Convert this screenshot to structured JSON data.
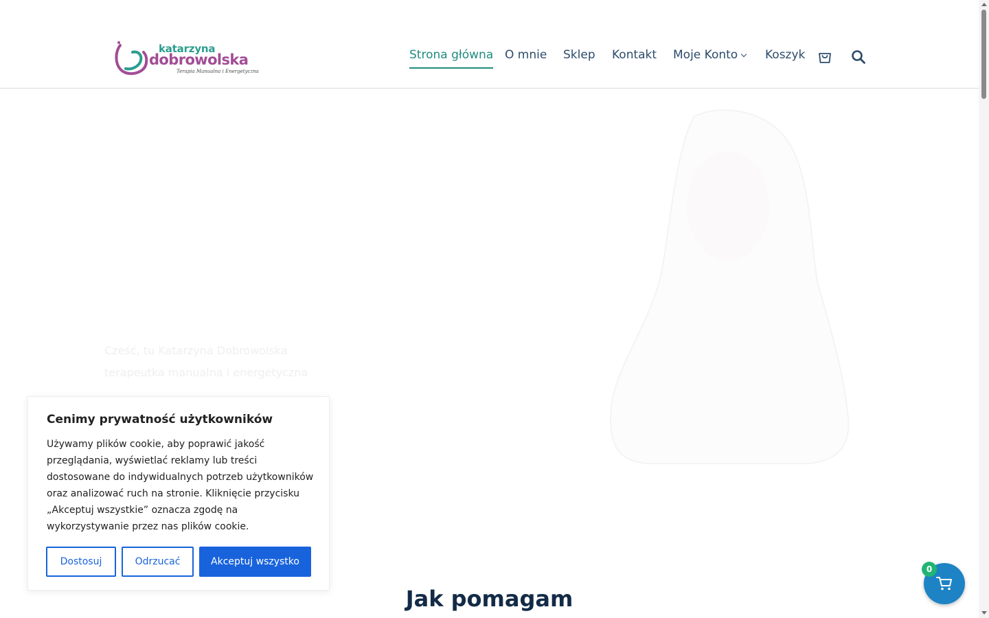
{
  "logo": {
    "line1": "katarzyna",
    "line2": "dobrowolska",
    "tagline": "Terapia Manualna i Energetyczna"
  },
  "nav": {
    "items": [
      {
        "label": "Strona główna",
        "active": true
      },
      {
        "label": "O mnie"
      },
      {
        "label": "Sklep"
      },
      {
        "label": "Kontakt"
      },
      {
        "label": "Moje Konto",
        "has_dropdown": true
      },
      {
        "label": "Koszyk"
      }
    ],
    "icons": [
      "cart-icon",
      "search-icon"
    ]
  },
  "hero": {
    "ghost_lines": [
      "Cześć, tu Katarzyna Dobrowolska",
      "terapeutka manualna i energetyczna"
    ]
  },
  "section": {
    "title": "Jak pomagam"
  },
  "cookie": {
    "title": "Cenimy prywatność użytkowników",
    "text": "Używamy plików cookie, aby poprawić jakość przeglądania, wyświetlać reklamy lub treści dostosowane do indywidualnych potrzeb użytkowników oraz analizować ruch na stronie. Kliknięcie przycisku „Akceptuj wszystkie” oznacza zgodę na wykorzystywanie przez nas plików cookie.",
    "buttons": {
      "customize": "Dostosuj",
      "reject": "Odrzucać",
      "accept": "Akceptuj wszystko"
    }
  },
  "minicart": {
    "count": "0"
  },
  "colors": {
    "accent": "#1f8c7f",
    "nav_text": "#2d4b6b",
    "cookie_button": "#1863dc",
    "cart_fab": "#1d83c5",
    "badge": "#21b573"
  }
}
